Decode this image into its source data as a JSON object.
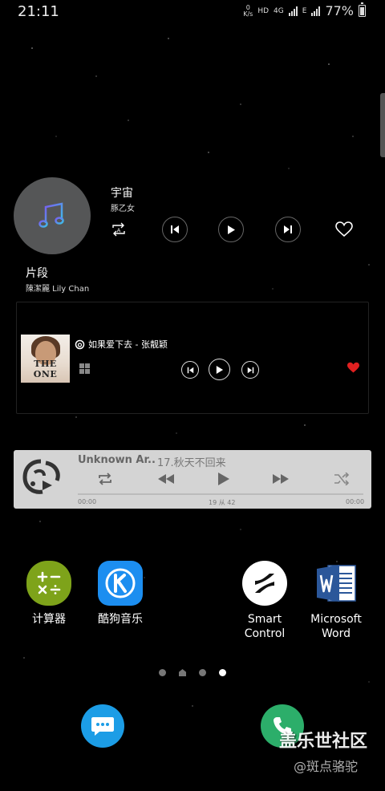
{
  "status_bar": {
    "time": "21:11",
    "net_speed_value": "0",
    "net_speed_unit": "K/s",
    "hd": "HD",
    "network": "4G",
    "data_type": "E",
    "battery_percent": "77%"
  },
  "widget_music_1": {
    "song_title": "宇宙",
    "artist": "豚乙女",
    "segment_title": "片段",
    "segment_artist": "陳潔麗 Lily Chan",
    "repeat_badge": "A"
  },
  "widget_music_2": {
    "album_label": "THE ONE",
    "song": "如果爱下去 - 张靓颖",
    "favorite_color": "#e02020"
  },
  "widget_music_3": {
    "artist": "Unknown Ar..",
    "title": "17.秋天不回来",
    "time_left": "00:00",
    "time_mid": "19 从 42",
    "time_right": "00:00",
    "progress": 0
  },
  "apps": {
    "calculator": "计算器",
    "kugou": "酷狗音乐",
    "smart_control_line1": "Smart",
    "smart_control_line2": "Control",
    "word_line1": "Microsoft",
    "word_line2": "Word"
  },
  "page_indicator": {
    "count": 4,
    "active_index": 3
  },
  "dock": {
    "left_icon": "messages-icon",
    "right_icon": "phone-icon"
  },
  "watermark": {
    "line1": "盖乐世社区",
    "line2": "@斑点骆驼"
  },
  "colors": {
    "calculator_bg": "#7ea31a",
    "kugou_bg": "#1c8ef0",
    "messages_bg": "#1c9de6",
    "phone_bg": "#2cae6a",
    "widget3_bg": "#d4d4d4"
  }
}
